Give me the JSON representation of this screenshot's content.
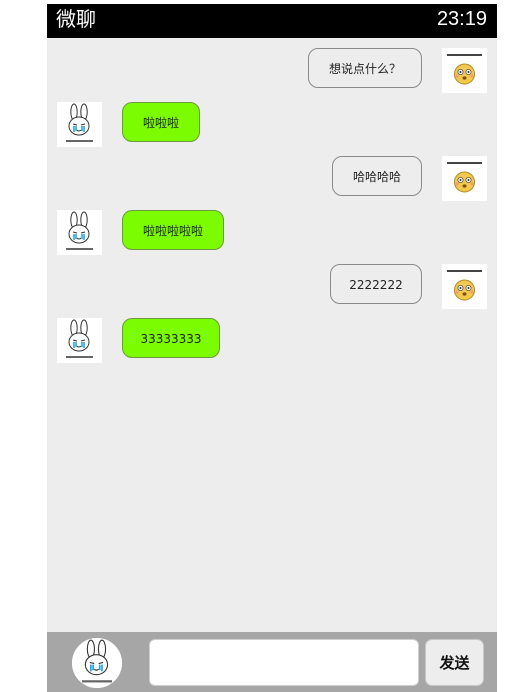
{
  "status_bar": {
    "app_title": "微聊",
    "time": "23:19"
  },
  "messages": [
    {
      "side": "sent",
      "text": "想说点什么？",
      "avatar": "emoji-avatar"
    },
    {
      "side": "recv",
      "text": "啦啦啦",
      "avatar": "rabbit-avatar"
    },
    {
      "side": "sent",
      "text": "哈哈哈哈",
      "avatar": "emoji-avatar"
    },
    {
      "side": "recv",
      "text": "啦啦啦啦啦",
      "avatar": "rabbit-avatar"
    },
    {
      "side": "sent",
      "text": "2222222",
      "avatar": "emoji-avatar"
    },
    {
      "side": "recv",
      "text": "33333333",
      "avatar": "rabbit-avatar"
    }
  ],
  "composer": {
    "input_value": "",
    "send_label": "发送"
  },
  "colors": {
    "status_bar": "#000000",
    "chat_background": "#ededed",
    "received_bubble": "#7cfc00",
    "bottom_bar": "#a6a6a6"
  }
}
